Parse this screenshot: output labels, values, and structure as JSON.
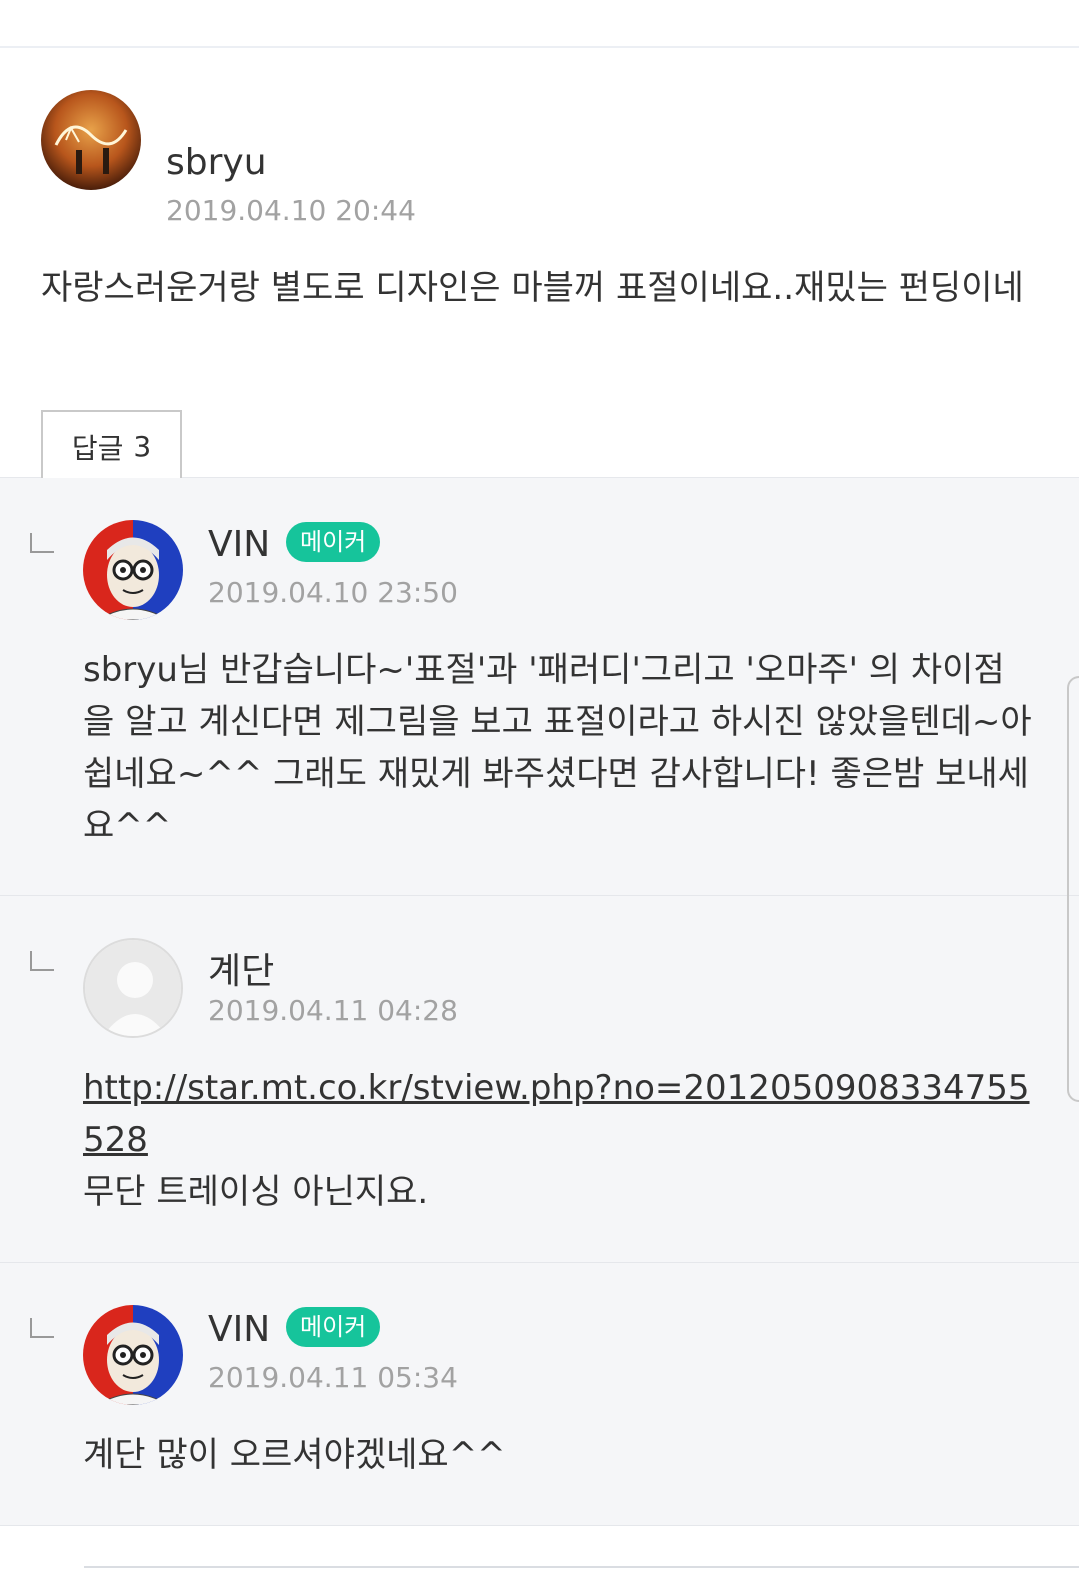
{
  "main_comment": {
    "username": "sbryu",
    "timestamp": "2019.04.10 20:44",
    "text": "자랑스러운거랑 별도로 디자인은 마블꺼 표절이네요..재밌는 펀딩이네",
    "reply_button": {
      "label": "답글",
      "count": "3"
    }
  },
  "replies": [
    {
      "username": "VIN",
      "badge": "메이커",
      "timestamp": "2019.04.10 23:50",
      "text": "sbryu님 반갑습니다~'표절'과 '패러디'그리고 '오마주' 의 차이점을 알고 계신다면 제그림을 보고 표절이라고 하시진 않았을텐데~아쉽네요~^^ 그래도 재밌게 봐주셨다면 감사합니다! 좋은밤 보내세요^^"
    },
    {
      "username": "계단",
      "timestamp": "2019.04.11 04:28",
      "link": "http://star.mt.co.kr/stview.php?no=2012050908334755528",
      "text": "무단 트레이싱 아닌지요."
    },
    {
      "username": "VIN",
      "badge": "메이커",
      "timestamp": "2019.04.11 05:34",
      "text": "계단 많이 오르셔야겠네요^^"
    }
  ]
}
